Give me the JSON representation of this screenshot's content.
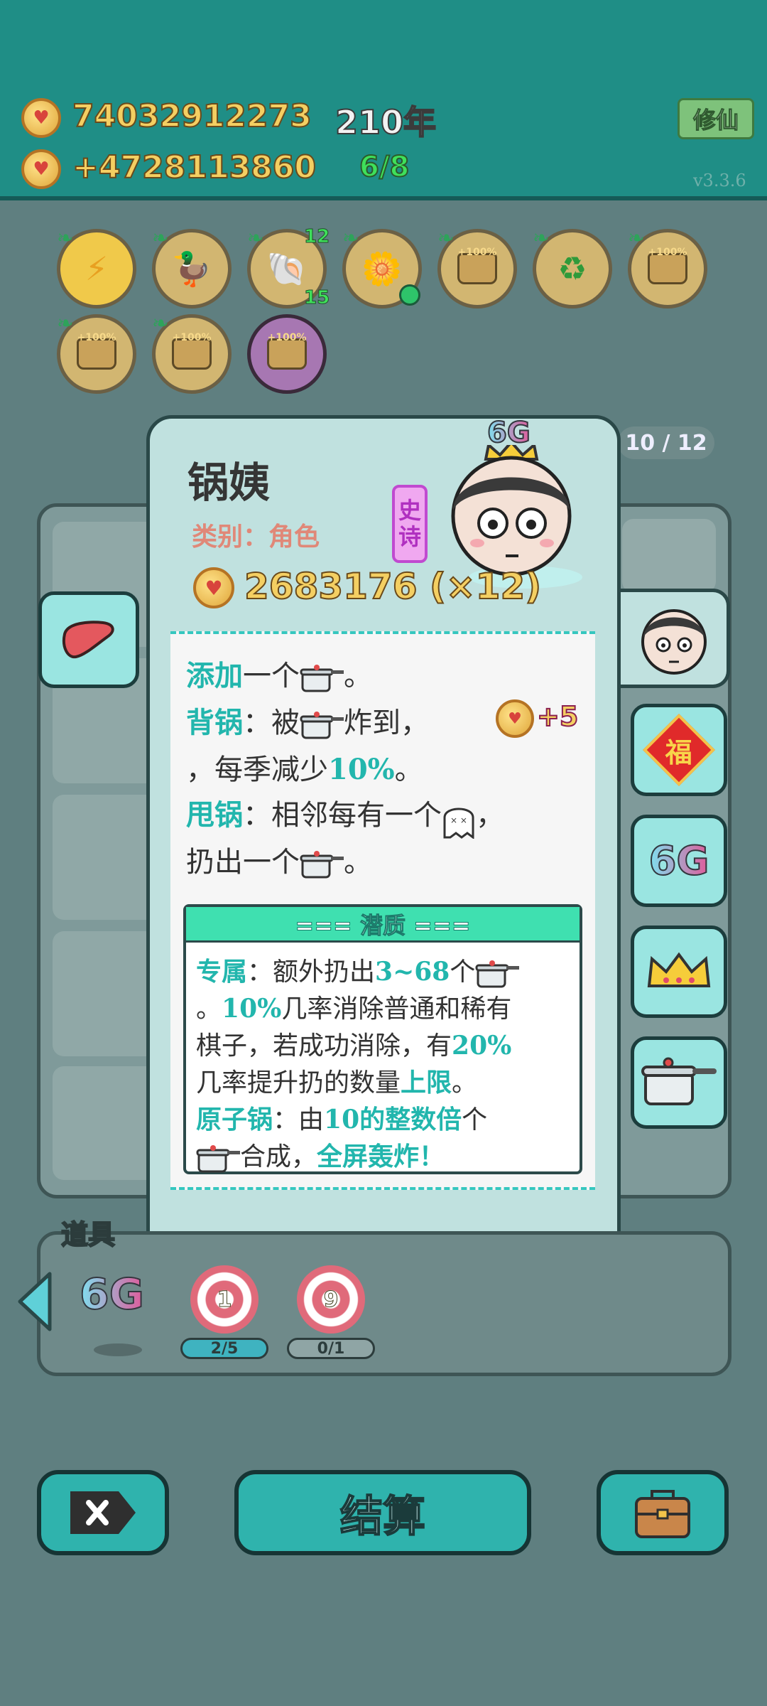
{
  "top": {
    "gold": "74032912273",
    "income": "+4728113860",
    "year": "210年",
    "slots": "6/8",
    "xiuxian_button": "修仙",
    "version": "v3.3.6"
  },
  "relics": [
    {
      "icon": "lightning-icon",
      "style": "gold"
    },
    {
      "icon": "duck-pot-icon",
      "style": "gold"
    },
    {
      "icon": "shell-icon",
      "style": "gold",
      "top_count": "12",
      "bottom_count": "15"
    },
    {
      "icon": "flower-pot-icon",
      "style": "gold"
    },
    {
      "icon": "pot-icon",
      "style": "purple",
      "label": "+100%"
    },
    {
      "icon": "recycle-icon",
      "style": "gold"
    },
    {
      "icon": "pot-icon",
      "style": "purple",
      "label": "+100%"
    },
    {
      "icon": "pot-icon",
      "style": "purple",
      "label": "+100%"
    },
    {
      "icon": "pot-icon",
      "style": "purple",
      "label": "+100%"
    },
    {
      "icon": "pot-icon",
      "style": "purple",
      "label": "+100%"
    }
  ],
  "page_indicator": "10 / 12",
  "card": {
    "name": "锅姨",
    "category": "类别：角色",
    "rarity_line1": "史",
    "rarity_line2": "诗",
    "badge": "6G",
    "value": "2683176 (×12)",
    "lines": {
      "l1_a": "添加",
      "l1_b": "一个",
      "l1_c": "。",
      "l2_a": "背锅",
      "l2_b": "：被",
      "l2_c": "炸到，",
      "l2_d": "+5",
      "l3_a": "，每季减少",
      "l3_b": "10%",
      "l3_c": "。",
      "l4_a": "甩锅",
      "l4_b": "：相邻每有一个",
      "l4_c": "，",
      "l5_a": "扔出一个",
      "l5_b": "。"
    },
    "potential": {
      "title": "=== 潜质 ===",
      "p1_a": "专属",
      "p1_b": "：额外扔出",
      "p1_c": "3~68",
      "p1_d": "个",
      "p2_a": "。",
      "p2_b": "10%",
      "p2_c": "几率消除普通和稀有",
      "p3": "棋子，若成功消除，有",
      "p3_b": "20%",
      "p4_a": "几率提升扔的数量",
      "p4_b": "上限",
      "p4_c": "。",
      "p5_a": "原子锅",
      "p5_b": "：由",
      "p5_c": "10的整数倍",
      "p5_d": "个",
      "p6_a": "合成，",
      "p6_b": "全屏轰炸！"
    }
  },
  "side_tabs": [
    "face-icon",
    "fu-icon",
    "6G",
    "crown-icon",
    "pressure-cooker-icon"
  ],
  "items": {
    "label": "道具",
    "sixg": "6G",
    "item1_num": "1",
    "item1_count": "2/5",
    "item2_num": "9",
    "item2_count": "0/1"
  },
  "bottom": {
    "settle": "结算"
  }
}
